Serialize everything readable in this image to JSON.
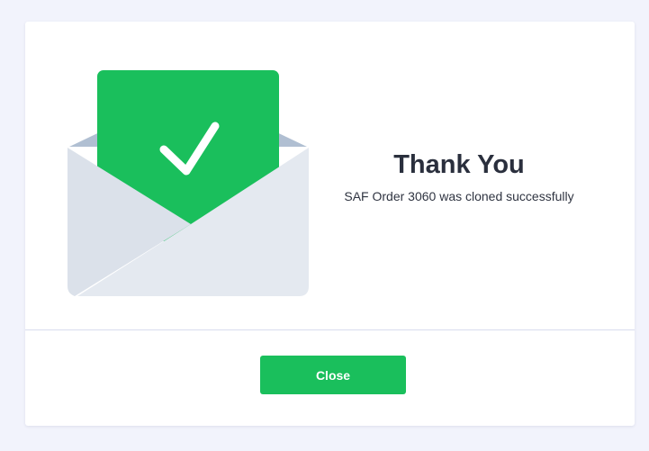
{
  "dialog": {
    "title": "Thank You",
    "message": "SAF Order 3060 was cloned successfully",
    "close_label": "Close"
  },
  "illustration": {
    "icon": "envelope-check-icon"
  },
  "colors": {
    "accent_green": "#1abf5c",
    "page_background": "#f2f3fc",
    "card_background": "#ffffff",
    "envelope_body": "#e3e8ef",
    "envelope_flap": "#b0bfd2"
  }
}
